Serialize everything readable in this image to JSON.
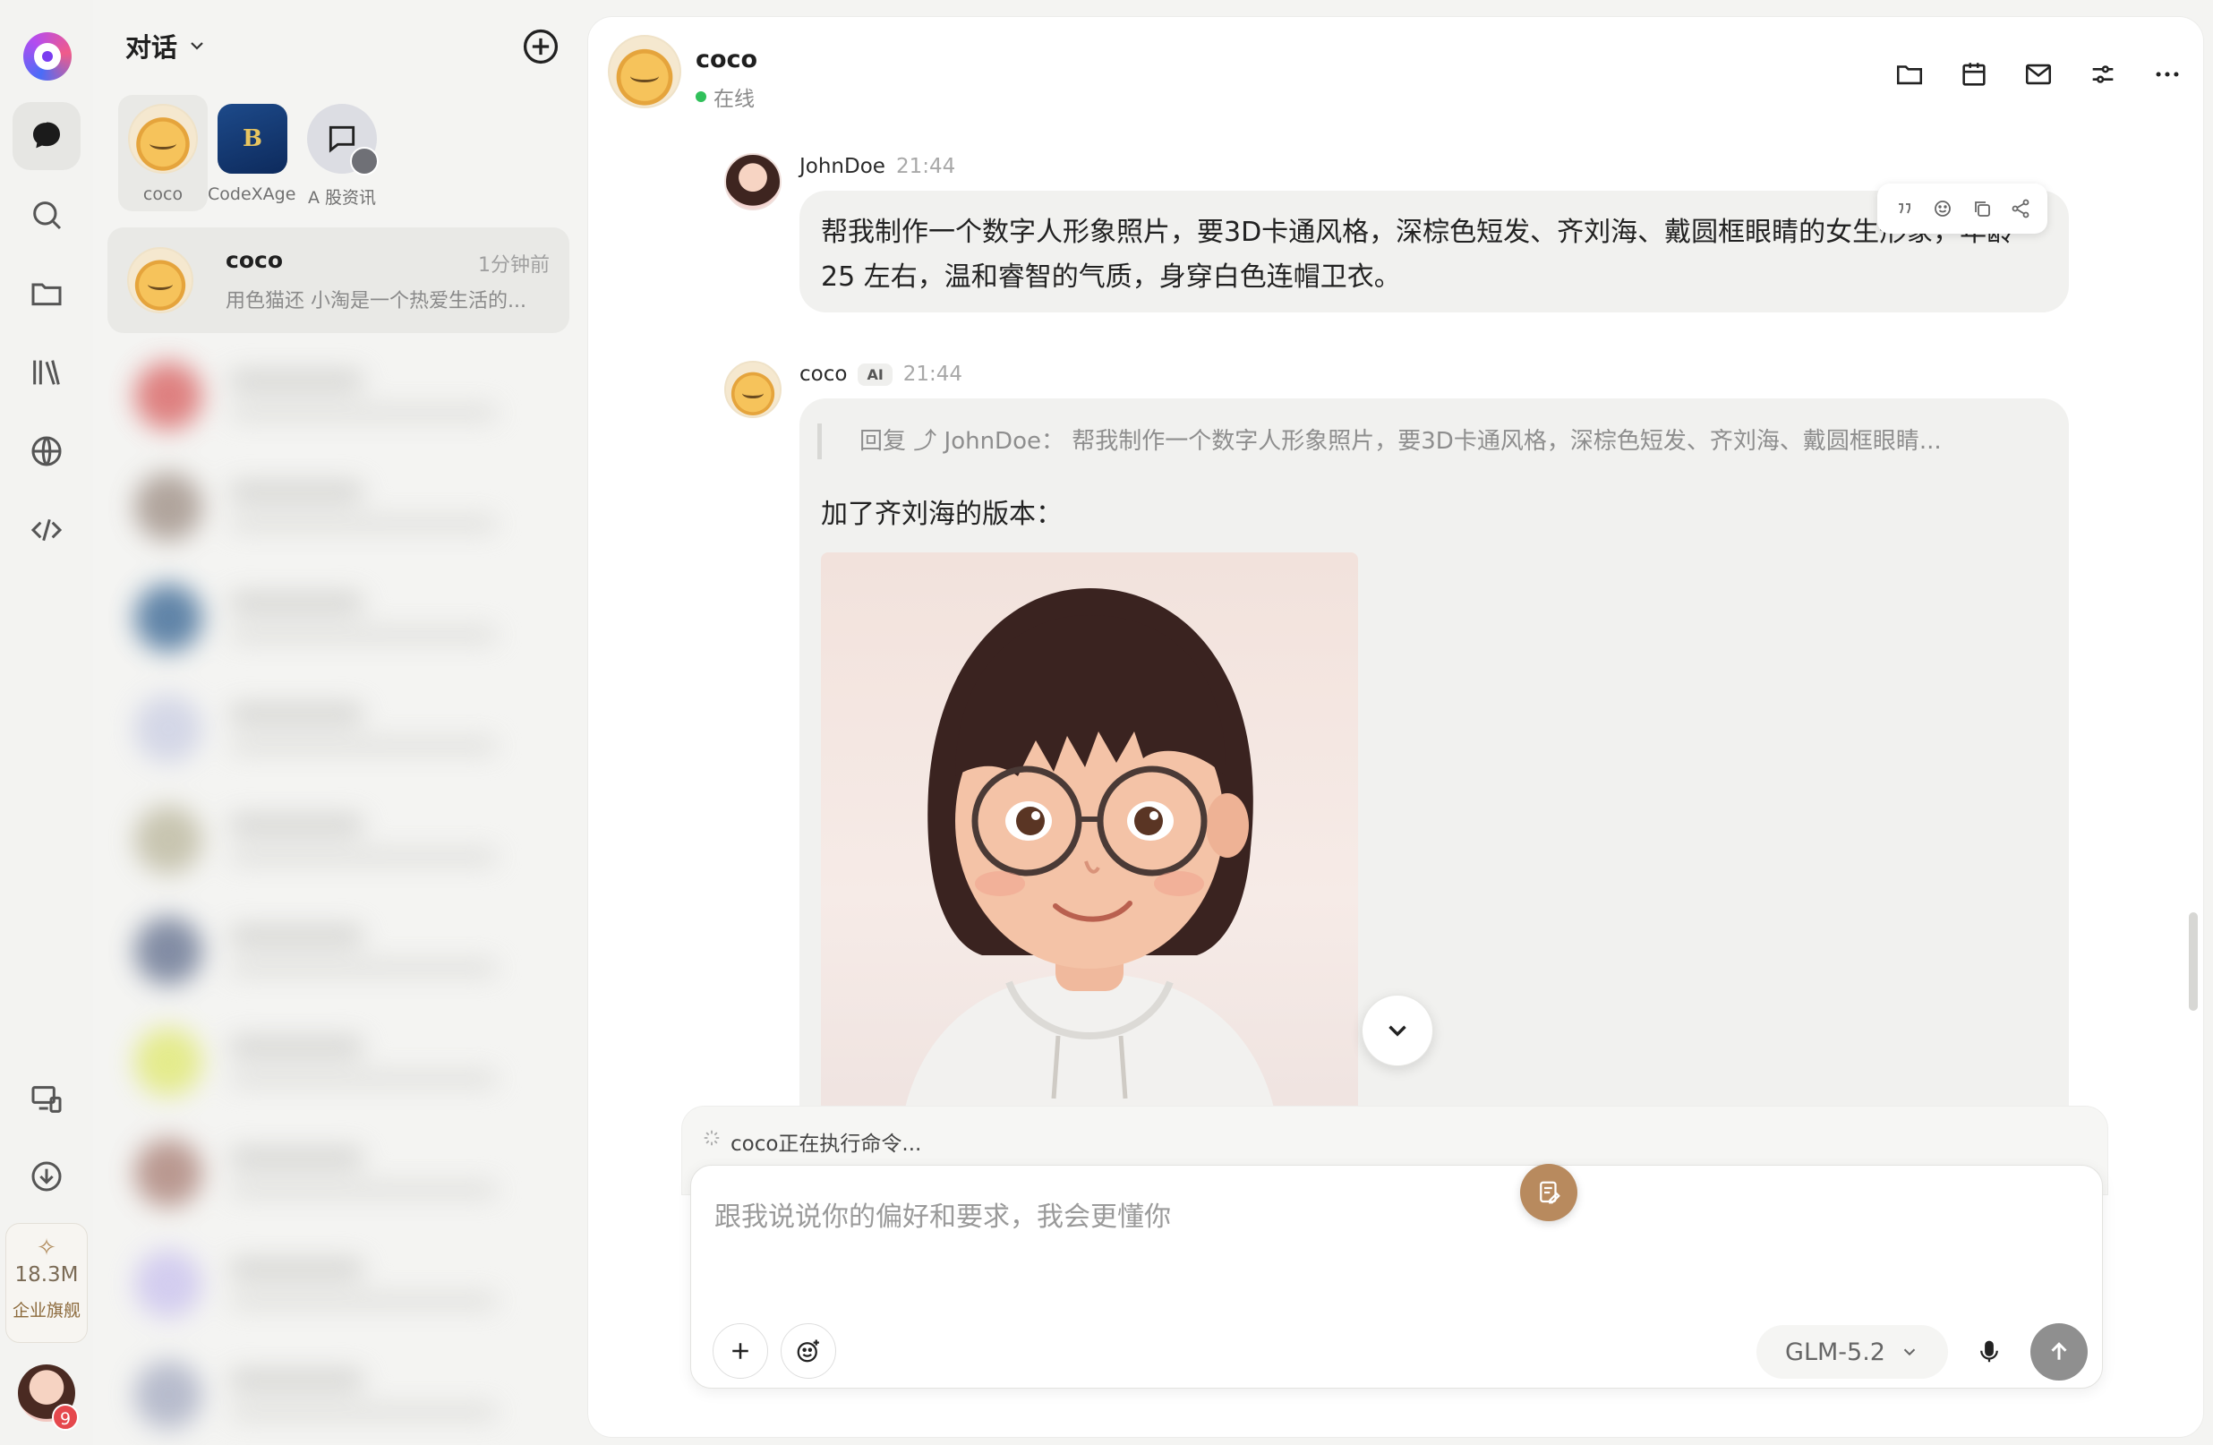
{
  "sidebar": {
    "title": "对话",
    "quota": {
      "value": "18.3M",
      "tier": "企业旗舰"
    },
    "user_badge": "9"
  },
  "pinned": [
    {
      "name": "coco"
    },
    {
      "name": "CodeXAgent"
    },
    {
      "name": "A 股资讯"
    }
  ],
  "conversation": {
    "name": "coco",
    "time": "1分钟前",
    "preview": "用色猫还 小淘是一个热爱生活的..."
  },
  "chat": {
    "name": "coco",
    "status": "在线"
  },
  "messages": {
    "user": {
      "author": "JohnDoe",
      "time": "21:44",
      "text": "帮我制作一个数字人形象照片，要3D卡通风格，深棕色短发、齐刘海、戴圆框眼睛的女生形象，年龄 25 左右，温和睿智的气质，身穿白色连帽卫衣。"
    },
    "ai": {
      "author": "coco",
      "tag": "AI",
      "time": "21:44",
      "quote": "回复 ⤴ JohnDoe：  帮我制作一个数字人形象照片，要3D卡通风格，深棕色短发、齐刘海、戴圆框眼睛...",
      "text": "加了齐刘海的版本："
    }
  },
  "composer": {
    "status": "coco正在执行命令...",
    "placeholder": "跟我说说你的偏好和要求，我会更懂你",
    "model": "GLM-5.2"
  },
  "colors": {
    "accent_brown": "#b88a5e",
    "online": "#30c05a",
    "badge": "#e5484d"
  }
}
